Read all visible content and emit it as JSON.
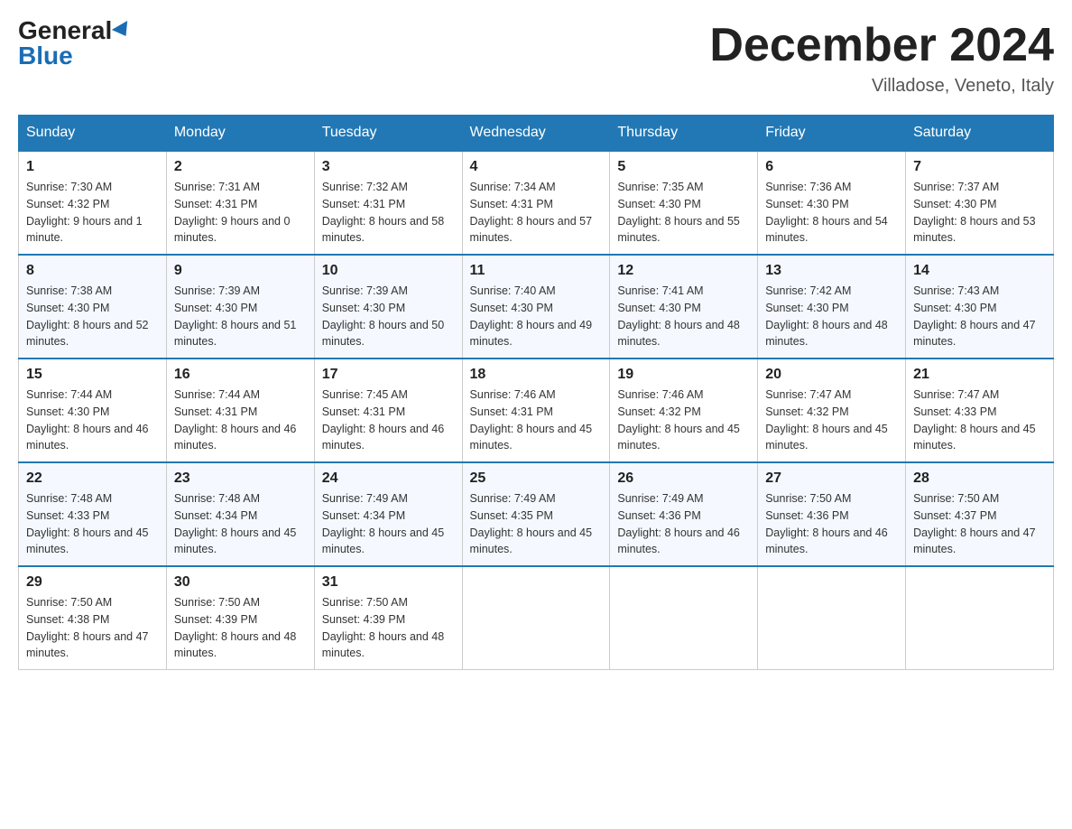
{
  "header": {
    "logo_general": "General",
    "logo_blue": "Blue",
    "month_title": "December 2024",
    "subtitle": "Villadose, Veneto, Italy"
  },
  "days_of_week": [
    "Sunday",
    "Monday",
    "Tuesday",
    "Wednesday",
    "Thursday",
    "Friday",
    "Saturday"
  ],
  "weeks": [
    [
      {
        "day": "1",
        "sunrise": "7:30 AM",
        "sunset": "4:32 PM",
        "daylight": "9 hours and 1 minute."
      },
      {
        "day": "2",
        "sunrise": "7:31 AM",
        "sunset": "4:31 PM",
        "daylight": "9 hours and 0 minutes."
      },
      {
        "day": "3",
        "sunrise": "7:32 AM",
        "sunset": "4:31 PM",
        "daylight": "8 hours and 58 minutes."
      },
      {
        "day": "4",
        "sunrise": "7:34 AM",
        "sunset": "4:31 PM",
        "daylight": "8 hours and 57 minutes."
      },
      {
        "day": "5",
        "sunrise": "7:35 AM",
        "sunset": "4:30 PM",
        "daylight": "8 hours and 55 minutes."
      },
      {
        "day": "6",
        "sunrise": "7:36 AM",
        "sunset": "4:30 PM",
        "daylight": "8 hours and 54 minutes."
      },
      {
        "day": "7",
        "sunrise": "7:37 AM",
        "sunset": "4:30 PM",
        "daylight": "8 hours and 53 minutes."
      }
    ],
    [
      {
        "day": "8",
        "sunrise": "7:38 AM",
        "sunset": "4:30 PM",
        "daylight": "8 hours and 52 minutes."
      },
      {
        "day": "9",
        "sunrise": "7:39 AM",
        "sunset": "4:30 PM",
        "daylight": "8 hours and 51 minutes."
      },
      {
        "day": "10",
        "sunrise": "7:39 AM",
        "sunset": "4:30 PM",
        "daylight": "8 hours and 50 minutes."
      },
      {
        "day": "11",
        "sunrise": "7:40 AM",
        "sunset": "4:30 PM",
        "daylight": "8 hours and 49 minutes."
      },
      {
        "day": "12",
        "sunrise": "7:41 AM",
        "sunset": "4:30 PM",
        "daylight": "8 hours and 48 minutes."
      },
      {
        "day": "13",
        "sunrise": "7:42 AM",
        "sunset": "4:30 PM",
        "daylight": "8 hours and 48 minutes."
      },
      {
        "day": "14",
        "sunrise": "7:43 AM",
        "sunset": "4:30 PM",
        "daylight": "8 hours and 47 minutes."
      }
    ],
    [
      {
        "day": "15",
        "sunrise": "7:44 AM",
        "sunset": "4:30 PM",
        "daylight": "8 hours and 46 minutes."
      },
      {
        "day": "16",
        "sunrise": "7:44 AM",
        "sunset": "4:31 PM",
        "daylight": "8 hours and 46 minutes."
      },
      {
        "day": "17",
        "sunrise": "7:45 AM",
        "sunset": "4:31 PM",
        "daylight": "8 hours and 46 minutes."
      },
      {
        "day": "18",
        "sunrise": "7:46 AM",
        "sunset": "4:31 PM",
        "daylight": "8 hours and 45 minutes."
      },
      {
        "day": "19",
        "sunrise": "7:46 AM",
        "sunset": "4:32 PM",
        "daylight": "8 hours and 45 minutes."
      },
      {
        "day": "20",
        "sunrise": "7:47 AM",
        "sunset": "4:32 PM",
        "daylight": "8 hours and 45 minutes."
      },
      {
        "day": "21",
        "sunrise": "7:47 AM",
        "sunset": "4:33 PM",
        "daylight": "8 hours and 45 minutes."
      }
    ],
    [
      {
        "day": "22",
        "sunrise": "7:48 AM",
        "sunset": "4:33 PM",
        "daylight": "8 hours and 45 minutes."
      },
      {
        "day": "23",
        "sunrise": "7:48 AM",
        "sunset": "4:34 PM",
        "daylight": "8 hours and 45 minutes."
      },
      {
        "day": "24",
        "sunrise": "7:49 AM",
        "sunset": "4:34 PM",
        "daylight": "8 hours and 45 minutes."
      },
      {
        "day": "25",
        "sunrise": "7:49 AM",
        "sunset": "4:35 PM",
        "daylight": "8 hours and 45 minutes."
      },
      {
        "day": "26",
        "sunrise": "7:49 AM",
        "sunset": "4:36 PM",
        "daylight": "8 hours and 46 minutes."
      },
      {
        "day": "27",
        "sunrise": "7:50 AM",
        "sunset": "4:36 PM",
        "daylight": "8 hours and 46 minutes."
      },
      {
        "day": "28",
        "sunrise": "7:50 AM",
        "sunset": "4:37 PM",
        "daylight": "8 hours and 47 minutes."
      }
    ],
    [
      {
        "day": "29",
        "sunrise": "7:50 AM",
        "sunset": "4:38 PM",
        "daylight": "8 hours and 47 minutes."
      },
      {
        "day": "30",
        "sunrise": "7:50 AM",
        "sunset": "4:39 PM",
        "daylight": "8 hours and 48 minutes."
      },
      {
        "day": "31",
        "sunrise": "7:50 AM",
        "sunset": "4:39 PM",
        "daylight": "8 hours and 48 minutes."
      },
      null,
      null,
      null,
      null
    ]
  ],
  "labels": {
    "sunrise": "Sunrise:",
    "sunset": "Sunset:",
    "daylight": "Daylight:"
  }
}
